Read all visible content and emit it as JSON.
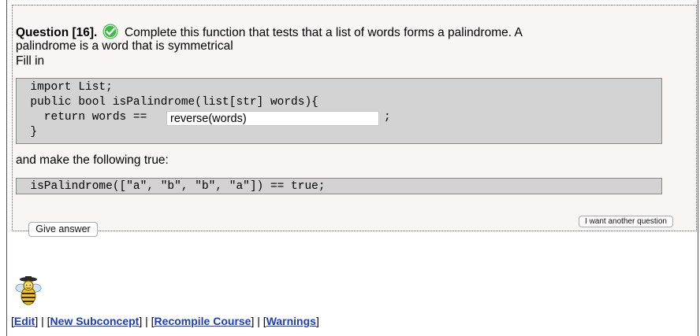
{
  "question": {
    "title": "Question [16].",
    "text_line1": "Complete this function that tests that a list of words forms a palindrome. A",
    "text_line2": "palindrome is a word that is symmetrical",
    "fill_in": "Fill in",
    "status_icon": "check-circle-icon",
    "status_color": "#3bbd45"
  },
  "code1": {
    "line1": "  import List;",
    "line2": "  public bool isPalindrome(list[str] words){",
    "line3_prefix": "    return words == ",
    "line3_suffix": ";",
    "line4": "  }",
    "answer_value": "reverse(words)"
  },
  "middle_text": "and make the following true:",
  "code2": {
    "line1": "  isPalindrome([\"a\", \"b\", \"b\", \"a\"]) == true;"
  },
  "buttons": {
    "another_question": "I want another question",
    "give_answer": "Give answer"
  },
  "footer": {
    "links": [
      "Edit",
      "New Subconcept",
      "Recompile Course",
      "Warnings"
    ]
  }
}
